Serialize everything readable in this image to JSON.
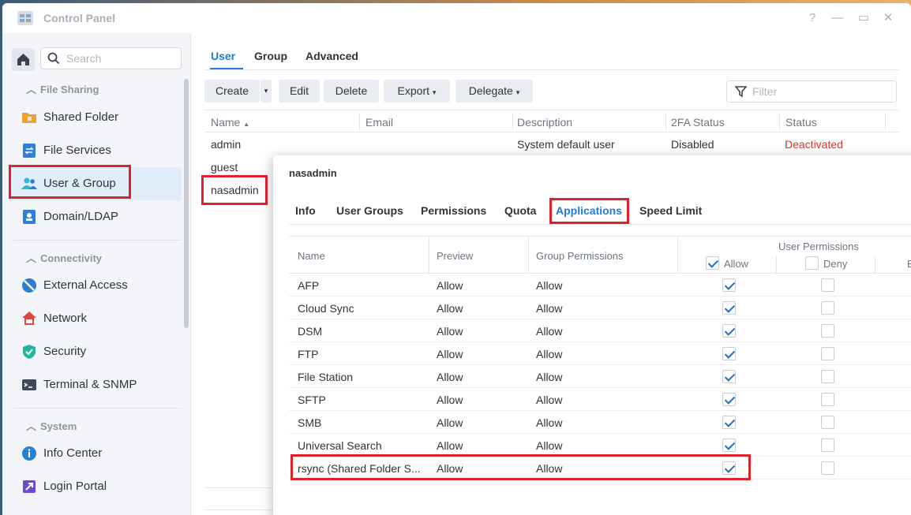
{
  "window": {
    "title": "Control Panel"
  },
  "sidebar": {
    "search_placeholder": "Search",
    "sections": [
      {
        "label": "File Sharing"
      },
      {
        "label": "Connectivity"
      },
      {
        "label": "System"
      }
    ],
    "items": [
      {
        "label": "Shared Folder",
        "icon": "folder-icon"
      },
      {
        "label": "File Services",
        "icon": "file-services-icon"
      },
      {
        "label": "User & Group",
        "icon": "user-group-icon",
        "active": true
      },
      {
        "label": "Domain/LDAP",
        "icon": "domain-icon"
      },
      {
        "label": "External Access",
        "icon": "external-access-icon"
      },
      {
        "label": "Network",
        "icon": "network-icon"
      },
      {
        "label": "Security",
        "icon": "shield-icon"
      },
      {
        "label": "Terminal & SNMP",
        "icon": "terminal-icon"
      },
      {
        "label": "Info Center",
        "icon": "info-icon"
      },
      {
        "label": "Login Portal",
        "icon": "login-portal-icon"
      }
    ]
  },
  "main": {
    "tabs": [
      {
        "label": "User"
      },
      {
        "label": "Group"
      },
      {
        "label": "Advanced"
      }
    ],
    "toolbar": {
      "create": "Create",
      "edit": "Edit",
      "delete": "Delete",
      "export": "Export",
      "delegate": "Delegate",
      "filter_placeholder": "Filter"
    },
    "columns": [
      "Name",
      "Email",
      "Description",
      "2FA Status",
      "Status"
    ],
    "users": [
      {
        "name": "admin",
        "email": "",
        "description": "System default user",
        "twofa": "Disabled",
        "status": "Deactivated"
      },
      {
        "name": "guest"
      },
      {
        "name": "nasadmin"
      }
    ]
  },
  "modal": {
    "title": "nasadmin",
    "tabs": [
      {
        "label": "Info"
      },
      {
        "label": "User Groups"
      },
      {
        "label": "Permissions"
      },
      {
        "label": "Quota"
      },
      {
        "label": "Applications"
      },
      {
        "label": "Speed Limit"
      }
    ],
    "columns": {
      "name": "Name",
      "preview": "Preview",
      "group_permissions": "Group Permissions",
      "user_permissions": "User Permissions",
      "allow": "Allow",
      "deny": "Deny",
      "extra": "B"
    },
    "rows": [
      {
        "name": "AFP",
        "preview": "Allow",
        "group": "Allow",
        "allow": true,
        "deny": false
      },
      {
        "name": "Cloud Sync",
        "preview": "Allow",
        "group": "Allow",
        "allow": true,
        "deny": false
      },
      {
        "name": "DSM",
        "preview": "Allow",
        "group": "Allow",
        "allow": true,
        "deny": false
      },
      {
        "name": "FTP",
        "preview": "Allow",
        "group": "Allow",
        "allow": true,
        "deny": false
      },
      {
        "name": "File Station",
        "preview": "Allow",
        "group": "Allow",
        "allow": true,
        "deny": false
      },
      {
        "name": "SFTP",
        "preview": "Allow",
        "group": "Allow",
        "allow": true,
        "deny": false
      },
      {
        "name": "SMB",
        "preview": "Allow",
        "group": "Allow",
        "allow": true,
        "deny": false
      },
      {
        "name": "Universal Search",
        "preview": "Allow",
        "group": "Allow",
        "allow": true,
        "deny": false
      },
      {
        "name": "rsync (Shared Folder S...",
        "preview": "Allow",
        "group": "Allow",
        "allow": true,
        "deny": false
      }
    ]
  },
  "colors": {
    "accent": "#1f7bd3",
    "highlight": "#e0202a",
    "status_deactivated": "#d9342b"
  }
}
